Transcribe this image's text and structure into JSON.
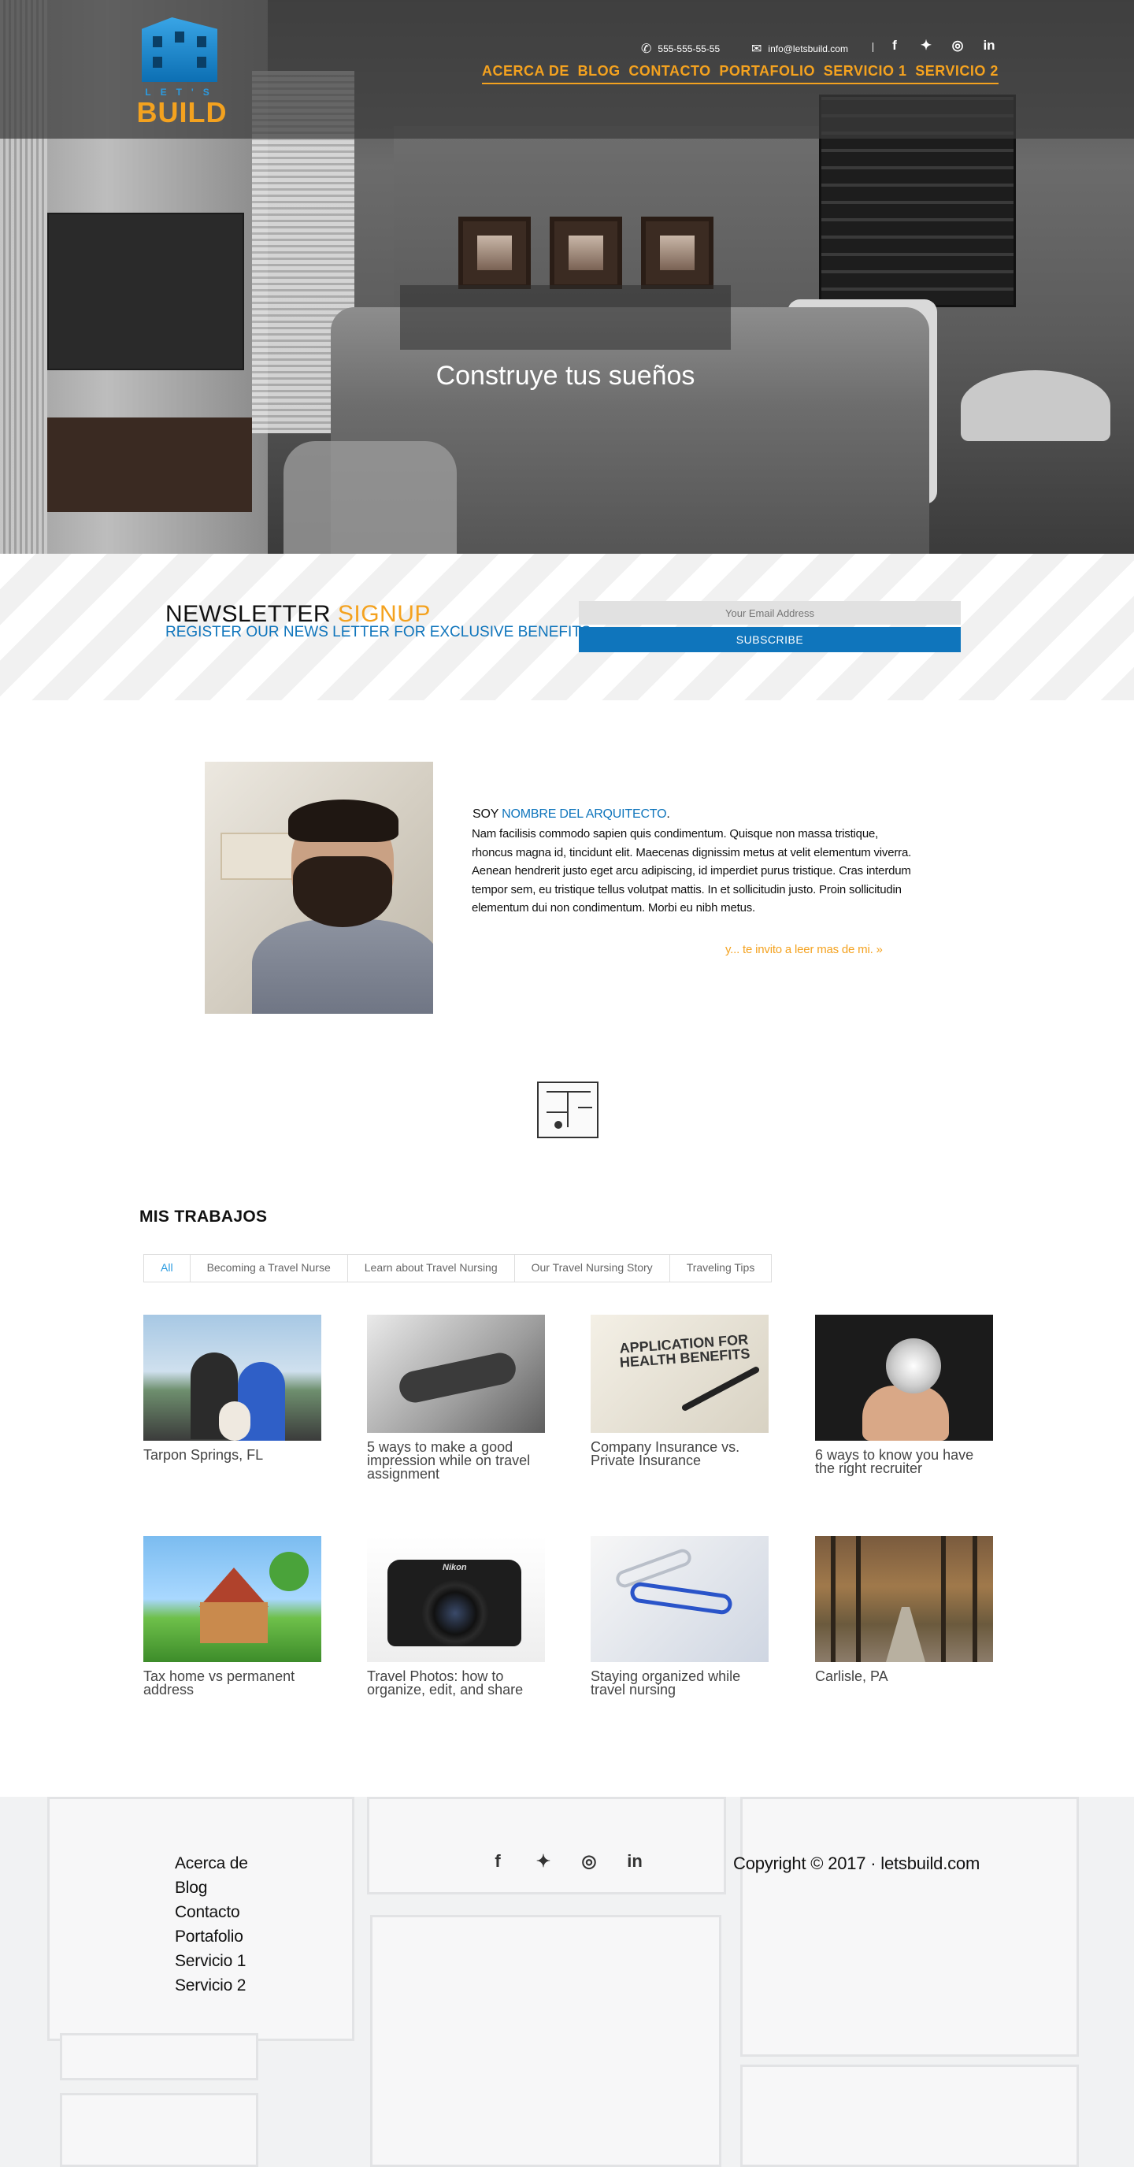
{
  "logo": {
    "lets": "LET'S",
    "build": "BUILD"
  },
  "header": {
    "phone": "555-555-55-55",
    "email": "info@letsbuild.com",
    "social": [
      "facebook",
      "twitter",
      "instagram",
      "linkedin"
    ],
    "nav": [
      "ACERCA DE",
      "BLOG",
      "CONTACTO",
      "PORTAFOLIO",
      "SERVICIO 1",
      "SERVICIO 2"
    ]
  },
  "hero": {
    "tagline": "Construye tus sueños"
  },
  "newsletter": {
    "title_main": "NEWSLETTER ",
    "title_accent": "SIGNUP",
    "subtitle": "REGISTER OUR NEWS LETTER FOR EXCLUSIVE BENEFITS",
    "email_placeholder": "Your Email Address",
    "subscribe_label": "SUBSCRIBE"
  },
  "about": {
    "prefix": "SOY ",
    "name": "NOMBRE DEL ARQUITECTO",
    "suffix": ".",
    "body": "Nam facilisis commodo sapien quis condimentum. Quisque non massa tristique, rhoncus magna id, tincidunt elit. Maecenas dignissim metus at velit elementum viverra. Aenean hendrerit justo eget arcu adipiscing, id imperdiet purus tristique. Cras interdum tempor sem, eu tristique tellus volutpat mattis. In et sollicitudin justo. Proin sollicitudin elementum dui non condimentum. Morbi eu nibh metus.",
    "read_more": "y... te invito a leer mas de mi. »"
  },
  "works": {
    "title": "MIS TRABAJOS",
    "tabs": [
      "All",
      "Becoming a Travel Nurse",
      "Learn about Travel Nursing",
      "Our Travel Nursing Story",
      "Traveling Tips"
    ],
    "active_tab": "All",
    "items": [
      {
        "caption": "Tarpon Springs, FL",
        "thumb": "family-photo"
      },
      {
        "caption": "5 ways to make a good impression while on travel assignment",
        "thumb": "handshake-photo"
      },
      {
        "caption": "Company Insurance vs. Private Insurance",
        "thumb": "health-benefits-form",
        "thumb_text": "APPLICATION FOR HEALTH BENEFITS"
      },
      {
        "caption": "6 ways to know you have the right recruiter",
        "thumb": "dandelion-photo"
      },
      {
        "caption": "Tax home vs permanent address",
        "thumb": "cartoon-house"
      },
      {
        "caption": "Travel Photos: how to organize, edit, and share",
        "thumb": "camera-photo",
        "thumb_text": "Nikon"
      },
      {
        "caption": "Staying organized while travel nursing",
        "thumb": "paperclips-photo"
      },
      {
        "caption": "Carlisle, PA",
        "thumb": "forest-path-photo"
      }
    ]
  },
  "footer": {
    "links": [
      "Acerca de",
      "Blog",
      "Contacto",
      "Portafolio",
      "Servicio 1",
      "Servicio 2"
    ],
    "social": [
      "facebook",
      "twitter",
      "instagram",
      "linkedin"
    ],
    "copyright": "Copyright © 2017 · letsbuild.com"
  },
  "colors": {
    "accent_orange": "#f4a21f",
    "accent_blue": "#0f75bc"
  }
}
